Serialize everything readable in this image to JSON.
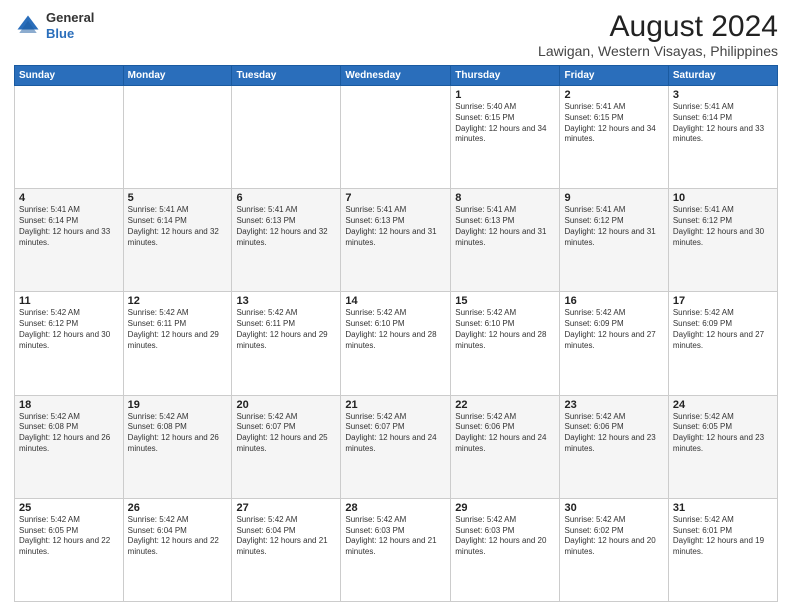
{
  "logo": {
    "general": "General",
    "blue": "Blue"
  },
  "header": {
    "title": "August 2024",
    "subtitle": "Lawigan, Western Visayas, Philippines"
  },
  "weekdays": [
    "Sunday",
    "Monday",
    "Tuesday",
    "Wednesday",
    "Thursday",
    "Friday",
    "Saturday"
  ],
  "weeks": [
    [
      {
        "day": "",
        "sunrise": "",
        "sunset": "",
        "daylight": ""
      },
      {
        "day": "",
        "sunrise": "",
        "sunset": "",
        "daylight": ""
      },
      {
        "day": "",
        "sunrise": "",
        "sunset": "",
        "daylight": ""
      },
      {
        "day": "",
        "sunrise": "",
        "sunset": "",
        "daylight": ""
      },
      {
        "day": "1",
        "sunrise": "Sunrise: 5:40 AM",
        "sunset": "Sunset: 6:15 PM",
        "daylight": "Daylight: 12 hours and 34 minutes."
      },
      {
        "day": "2",
        "sunrise": "Sunrise: 5:41 AM",
        "sunset": "Sunset: 6:15 PM",
        "daylight": "Daylight: 12 hours and 34 minutes."
      },
      {
        "day": "3",
        "sunrise": "Sunrise: 5:41 AM",
        "sunset": "Sunset: 6:14 PM",
        "daylight": "Daylight: 12 hours and 33 minutes."
      }
    ],
    [
      {
        "day": "4",
        "sunrise": "Sunrise: 5:41 AM",
        "sunset": "Sunset: 6:14 PM",
        "daylight": "Daylight: 12 hours and 33 minutes."
      },
      {
        "day": "5",
        "sunrise": "Sunrise: 5:41 AM",
        "sunset": "Sunset: 6:14 PM",
        "daylight": "Daylight: 12 hours and 32 minutes."
      },
      {
        "day": "6",
        "sunrise": "Sunrise: 5:41 AM",
        "sunset": "Sunset: 6:13 PM",
        "daylight": "Daylight: 12 hours and 32 minutes."
      },
      {
        "day": "7",
        "sunrise": "Sunrise: 5:41 AM",
        "sunset": "Sunset: 6:13 PM",
        "daylight": "Daylight: 12 hours and 31 minutes."
      },
      {
        "day": "8",
        "sunrise": "Sunrise: 5:41 AM",
        "sunset": "Sunset: 6:13 PM",
        "daylight": "Daylight: 12 hours and 31 minutes."
      },
      {
        "day": "9",
        "sunrise": "Sunrise: 5:41 AM",
        "sunset": "Sunset: 6:12 PM",
        "daylight": "Daylight: 12 hours and 31 minutes."
      },
      {
        "day": "10",
        "sunrise": "Sunrise: 5:41 AM",
        "sunset": "Sunset: 6:12 PM",
        "daylight": "Daylight: 12 hours and 30 minutes."
      }
    ],
    [
      {
        "day": "11",
        "sunrise": "Sunrise: 5:42 AM",
        "sunset": "Sunset: 6:12 PM",
        "daylight": "Daylight: 12 hours and 30 minutes."
      },
      {
        "day": "12",
        "sunrise": "Sunrise: 5:42 AM",
        "sunset": "Sunset: 6:11 PM",
        "daylight": "Daylight: 12 hours and 29 minutes."
      },
      {
        "day": "13",
        "sunrise": "Sunrise: 5:42 AM",
        "sunset": "Sunset: 6:11 PM",
        "daylight": "Daylight: 12 hours and 29 minutes."
      },
      {
        "day": "14",
        "sunrise": "Sunrise: 5:42 AM",
        "sunset": "Sunset: 6:10 PM",
        "daylight": "Daylight: 12 hours and 28 minutes."
      },
      {
        "day": "15",
        "sunrise": "Sunrise: 5:42 AM",
        "sunset": "Sunset: 6:10 PM",
        "daylight": "Daylight: 12 hours and 28 minutes."
      },
      {
        "day": "16",
        "sunrise": "Sunrise: 5:42 AM",
        "sunset": "Sunset: 6:09 PM",
        "daylight": "Daylight: 12 hours and 27 minutes."
      },
      {
        "day": "17",
        "sunrise": "Sunrise: 5:42 AM",
        "sunset": "Sunset: 6:09 PM",
        "daylight": "Daylight: 12 hours and 27 minutes."
      }
    ],
    [
      {
        "day": "18",
        "sunrise": "Sunrise: 5:42 AM",
        "sunset": "Sunset: 6:08 PM",
        "daylight": "Daylight: 12 hours and 26 minutes."
      },
      {
        "day": "19",
        "sunrise": "Sunrise: 5:42 AM",
        "sunset": "Sunset: 6:08 PM",
        "daylight": "Daylight: 12 hours and 26 minutes."
      },
      {
        "day": "20",
        "sunrise": "Sunrise: 5:42 AM",
        "sunset": "Sunset: 6:07 PM",
        "daylight": "Daylight: 12 hours and 25 minutes."
      },
      {
        "day": "21",
        "sunrise": "Sunrise: 5:42 AM",
        "sunset": "Sunset: 6:07 PM",
        "daylight": "Daylight: 12 hours and 24 minutes."
      },
      {
        "day": "22",
        "sunrise": "Sunrise: 5:42 AM",
        "sunset": "Sunset: 6:06 PM",
        "daylight": "Daylight: 12 hours and 24 minutes."
      },
      {
        "day": "23",
        "sunrise": "Sunrise: 5:42 AM",
        "sunset": "Sunset: 6:06 PM",
        "daylight": "Daylight: 12 hours and 23 minutes."
      },
      {
        "day": "24",
        "sunrise": "Sunrise: 5:42 AM",
        "sunset": "Sunset: 6:05 PM",
        "daylight": "Daylight: 12 hours and 23 minutes."
      }
    ],
    [
      {
        "day": "25",
        "sunrise": "Sunrise: 5:42 AM",
        "sunset": "Sunset: 6:05 PM",
        "daylight": "Daylight: 12 hours and 22 minutes."
      },
      {
        "day": "26",
        "sunrise": "Sunrise: 5:42 AM",
        "sunset": "Sunset: 6:04 PM",
        "daylight": "Daylight: 12 hours and 22 minutes."
      },
      {
        "day": "27",
        "sunrise": "Sunrise: 5:42 AM",
        "sunset": "Sunset: 6:04 PM",
        "daylight": "Daylight: 12 hours and 21 minutes."
      },
      {
        "day": "28",
        "sunrise": "Sunrise: 5:42 AM",
        "sunset": "Sunset: 6:03 PM",
        "daylight": "Daylight: 12 hours and 21 minutes."
      },
      {
        "day": "29",
        "sunrise": "Sunrise: 5:42 AM",
        "sunset": "Sunset: 6:03 PM",
        "daylight": "Daylight: 12 hours and 20 minutes."
      },
      {
        "day": "30",
        "sunrise": "Sunrise: 5:42 AM",
        "sunset": "Sunset: 6:02 PM",
        "daylight": "Daylight: 12 hours and 20 minutes."
      },
      {
        "day": "31",
        "sunrise": "Sunrise: 5:42 AM",
        "sunset": "Sunset: 6:01 PM",
        "daylight": "Daylight: 12 hours and 19 minutes."
      }
    ]
  ]
}
